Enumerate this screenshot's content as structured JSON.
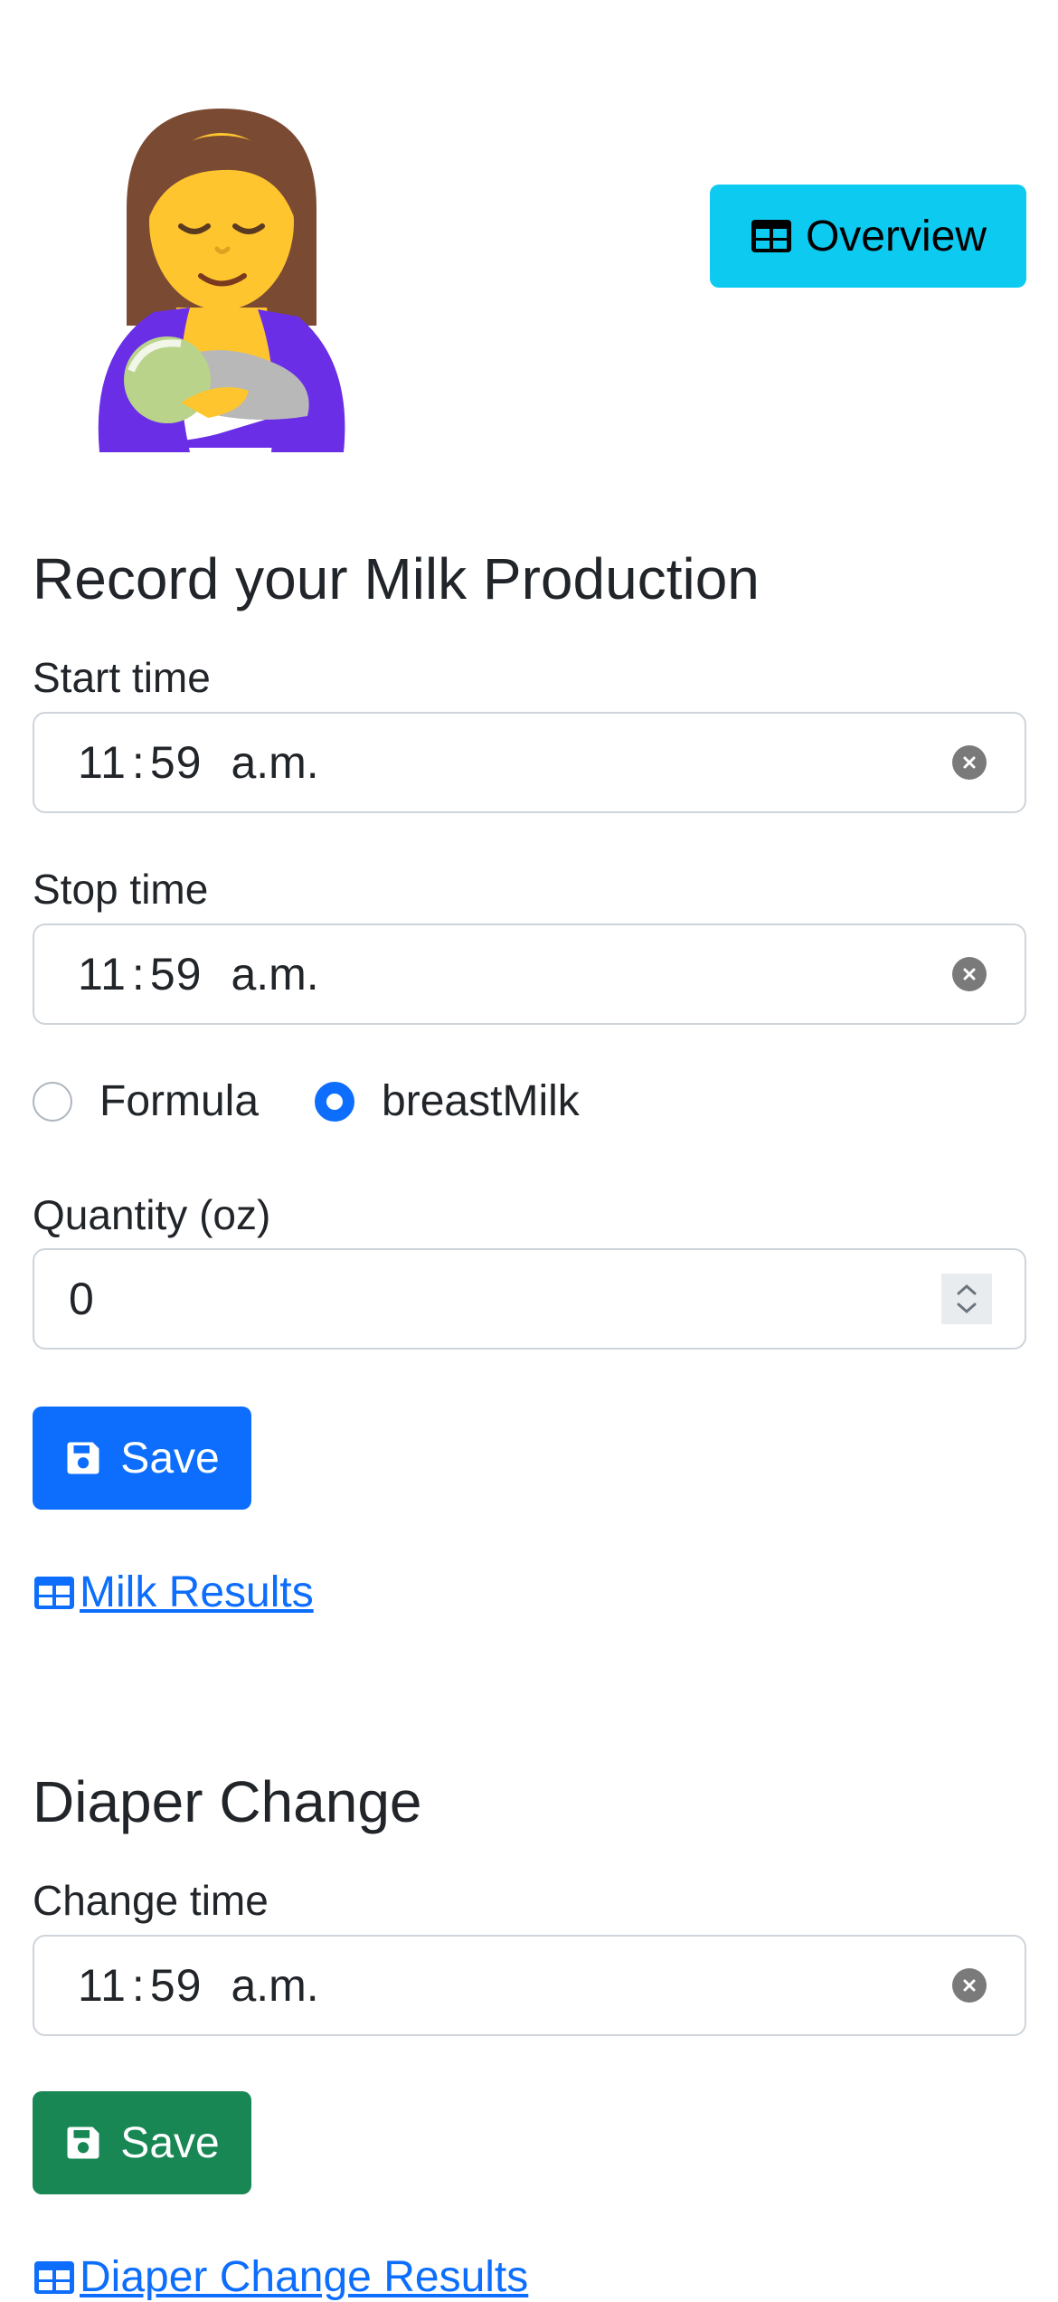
{
  "header": {
    "overview_label": "Overview"
  },
  "milk": {
    "title": "Record your Milk Production",
    "start_label": "Start time",
    "start_time": {
      "hour": "11",
      "minute": "59",
      "ampm": "a.m."
    },
    "stop_label": "Stop time",
    "stop_time": {
      "hour": "11",
      "minute": "59",
      "ampm": "a.m."
    },
    "options": [
      {
        "label": "Formula",
        "checked": false
      },
      {
        "label": "breastMilk",
        "checked": true
      }
    ],
    "quantity_label": "Quantity (oz)",
    "quantity_value": "0",
    "save_label": "Save",
    "results_link": "Milk Results"
  },
  "diaper": {
    "title": "Diaper Change",
    "change_label": "Change time",
    "change_time": {
      "hour": "11",
      "minute": "59",
      "ampm": "a.m."
    },
    "save_label": "Save",
    "results_link": "Diaper Change Results"
  },
  "colors": {
    "info": "#0dcaf0",
    "primary": "#0d6efd",
    "success": "#198754"
  },
  "icons": [
    "breastfeeding-woman-emoji",
    "table-icon",
    "clear-icon",
    "save-icon",
    "spinner-icon"
  ]
}
